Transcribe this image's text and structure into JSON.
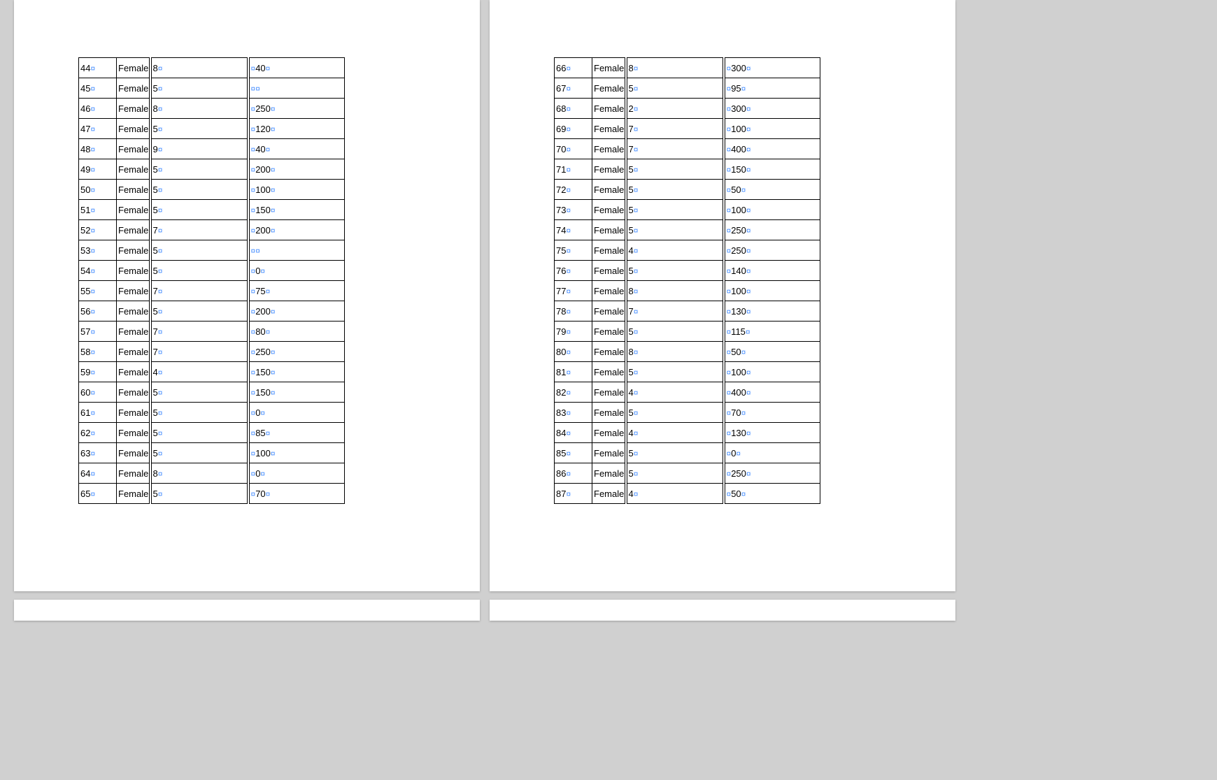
{
  "mark": "¤",
  "pageLeft": {
    "rows": [
      {
        "id": "44",
        "gender": "Female",
        "col3": "8",
        "col4": "40"
      },
      {
        "id": "45",
        "gender": "Female",
        "col3": "5",
        "col4": ""
      },
      {
        "id": "46",
        "gender": "Female",
        "col3": "8",
        "col4": "250"
      },
      {
        "id": "47",
        "gender": "Female",
        "col3": "5",
        "col4": "120"
      },
      {
        "id": "48",
        "gender": "Female",
        "col3": "9",
        "col4": "40"
      },
      {
        "id": "49",
        "gender": "Female",
        "col3": "5",
        "col4": "200"
      },
      {
        "id": "50",
        "gender": "Female",
        "col3": "5",
        "col4": "100"
      },
      {
        "id": "51",
        "gender": "Female",
        "col3": "5",
        "col4": "150"
      },
      {
        "id": "52",
        "gender": "Female",
        "col3": "7",
        "col4": "200"
      },
      {
        "id": "53",
        "gender": "Female",
        "col3": "5",
        "col4": ""
      },
      {
        "id": "54",
        "gender": "Female",
        "col3": "5",
        "col4": "0"
      },
      {
        "id": "55",
        "gender": "Female",
        "col3": "7",
        "col4": "75"
      },
      {
        "id": "56",
        "gender": "Female",
        "col3": "5",
        "col4": "200"
      },
      {
        "id": "57",
        "gender": "Female",
        "col3": "7",
        "col4": "80"
      },
      {
        "id": "58",
        "gender": "Female",
        "col3": "7",
        "col4": "250"
      },
      {
        "id": "59",
        "gender": "Female",
        "col3": "4",
        "col4": "150"
      },
      {
        "id": "60",
        "gender": "Female",
        "col3": "5",
        "col4": "150"
      },
      {
        "id": "61",
        "gender": "Female",
        "col3": "5",
        "col4": "0"
      },
      {
        "id": "62",
        "gender": "Female",
        "col3": "5",
        "col4": "85"
      },
      {
        "id": "63",
        "gender": "Female",
        "col3": "5",
        "col4": "100"
      },
      {
        "id": "64",
        "gender": "Female",
        "col3": "8",
        "col4": "0"
      },
      {
        "id": "65",
        "gender": "Female",
        "col3": "5",
        "col4": "70"
      }
    ]
  },
  "pageRight": {
    "rows": [
      {
        "id": "66",
        "gender": "Female",
        "col3": "8",
        "col4": "300"
      },
      {
        "id": "67",
        "gender": "Female",
        "col3": "5",
        "col4": "95"
      },
      {
        "id": "68",
        "gender": "Female",
        "col3": "2",
        "col4": "300"
      },
      {
        "id": "69",
        "gender": "Female",
        "col3": "7",
        "col4": "100"
      },
      {
        "id": "70",
        "gender": "Female",
        "col3": "7",
        "col4": "400"
      },
      {
        "id": "71",
        "gender": "Female",
        "col3": "5",
        "col4": "150"
      },
      {
        "id": "72",
        "gender": "Female",
        "col3": "5",
        "col4": "50"
      },
      {
        "id": "73",
        "gender": "Female",
        "col3": "5",
        "col4": "100"
      },
      {
        "id": "74",
        "gender": "Female",
        "col3": "5",
        "col4": "250"
      },
      {
        "id": "75",
        "gender": "Female",
        "col3": "4",
        "col4": "250"
      },
      {
        "id": "76",
        "gender": "Female",
        "col3": "5",
        "col4": "140"
      },
      {
        "id": "77",
        "gender": "Female",
        "col3": "8",
        "col4": "100"
      },
      {
        "id": "78",
        "gender": "Female",
        "col3": "7",
        "col4": "130"
      },
      {
        "id": "79",
        "gender": "Female",
        "col3": "5",
        "col4": "115"
      },
      {
        "id": "80",
        "gender": "Female",
        "col3": "8",
        "col4": "50"
      },
      {
        "id": "81",
        "gender": "Female",
        "col3": "5",
        "col4": "100"
      },
      {
        "id": "82",
        "gender": "Female",
        "col3": "4",
        "col4": "400"
      },
      {
        "id": "83",
        "gender": "Female",
        "col3": "5",
        "col4": "70"
      },
      {
        "id": "84",
        "gender": "Female",
        "col3": "4",
        "col4": "130"
      },
      {
        "id": "85",
        "gender": "Female",
        "col3": "5",
        "col4": "0"
      },
      {
        "id": "86",
        "gender": "Female",
        "col3": "5",
        "col4": "250"
      },
      {
        "id": "87",
        "gender": "Female",
        "col3": "4",
        "col4": "50"
      }
    ]
  }
}
